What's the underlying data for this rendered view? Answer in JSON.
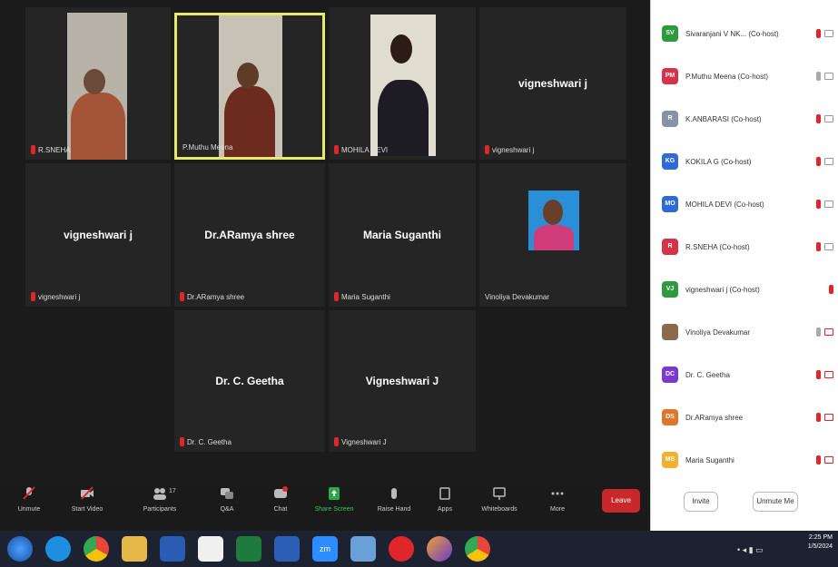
{
  "gallery": {
    "tiles": [
      {
        "label": "R.SNEHA",
        "type": "video"
      },
      {
        "label": "P.Muthu Meena",
        "type": "video",
        "active": true
      },
      {
        "label": "MOHILA DEVI",
        "type": "video"
      },
      {
        "label": "vigneshwari j",
        "center": "vigneshwari j"
      },
      {
        "label": "vigneshwari j",
        "center": "vigneshwari j"
      },
      {
        "label": "Dr.ARamya shree",
        "center": "Dr.ARamya shree"
      },
      {
        "label": "Maria Suganthi",
        "center": "Maria Suganthi"
      },
      {
        "label": "Vinoliya Devakumar",
        "type": "photo"
      },
      {
        "label": "Dr. C. Geetha",
        "center": "Dr. C. Geetha"
      },
      {
        "label": "Vigneshwari J",
        "center": "Vigneshwari J"
      }
    ]
  },
  "toolbar": {
    "unmute": "Unmute",
    "start_video": "Start Video",
    "participants": "Participants",
    "participants_count": "17",
    "qa": "Q&A",
    "chat": "Chat",
    "share_screen": "Share Screen",
    "raise_hand": "Raise Hand",
    "apps": "Apps",
    "whiteboards": "Whiteboards",
    "more": "More",
    "leave": "Leave"
  },
  "panel": {
    "participants": [
      {
        "initials": "SV",
        "name": "Sivaranjani V NK... (Co-host)",
        "color": "#2e9a3e"
      },
      {
        "initials": "PM",
        "name": "P.Muthu Meena (Co-host)",
        "color": "#d6334a"
      },
      {
        "initials": "R",
        "name": "K.ANBARASI (Co-host)",
        "color": "#8592a8"
      },
      {
        "initials": "KG",
        "name": "KOKILA G (Co-host)",
        "color": "#2f6bd6"
      },
      {
        "initials": "MO",
        "name": "MOHILA DEVI (Co-host)",
        "color": "#2f6bd6"
      },
      {
        "initials": "R",
        "name": "R.SNEHA (Co-host)",
        "color": "#d6334a"
      },
      {
        "initials": "VJ",
        "name": "vigneshwari j (Co-host)",
        "color": "#2e9a3e"
      },
      {
        "initials": "",
        "name": "Vinoliya Devakumar",
        "color": "#8a6a4a"
      },
      {
        "initials": "DC",
        "name": "Dr. C. Geetha",
        "color": "#7a3ad0"
      },
      {
        "initials": "DS",
        "name": "Dr.ARamya shree",
        "color": "#e0762a"
      },
      {
        "initials": "MS",
        "name": "Maria Suganthi",
        "color": "#f0b030"
      }
    ],
    "invite": "Invite",
    "unmute_me": "Unmute Me"
  },
  "taskbar": {
    "time": "2:25 PM",
    "date": "1/5/2024"
  }
}
